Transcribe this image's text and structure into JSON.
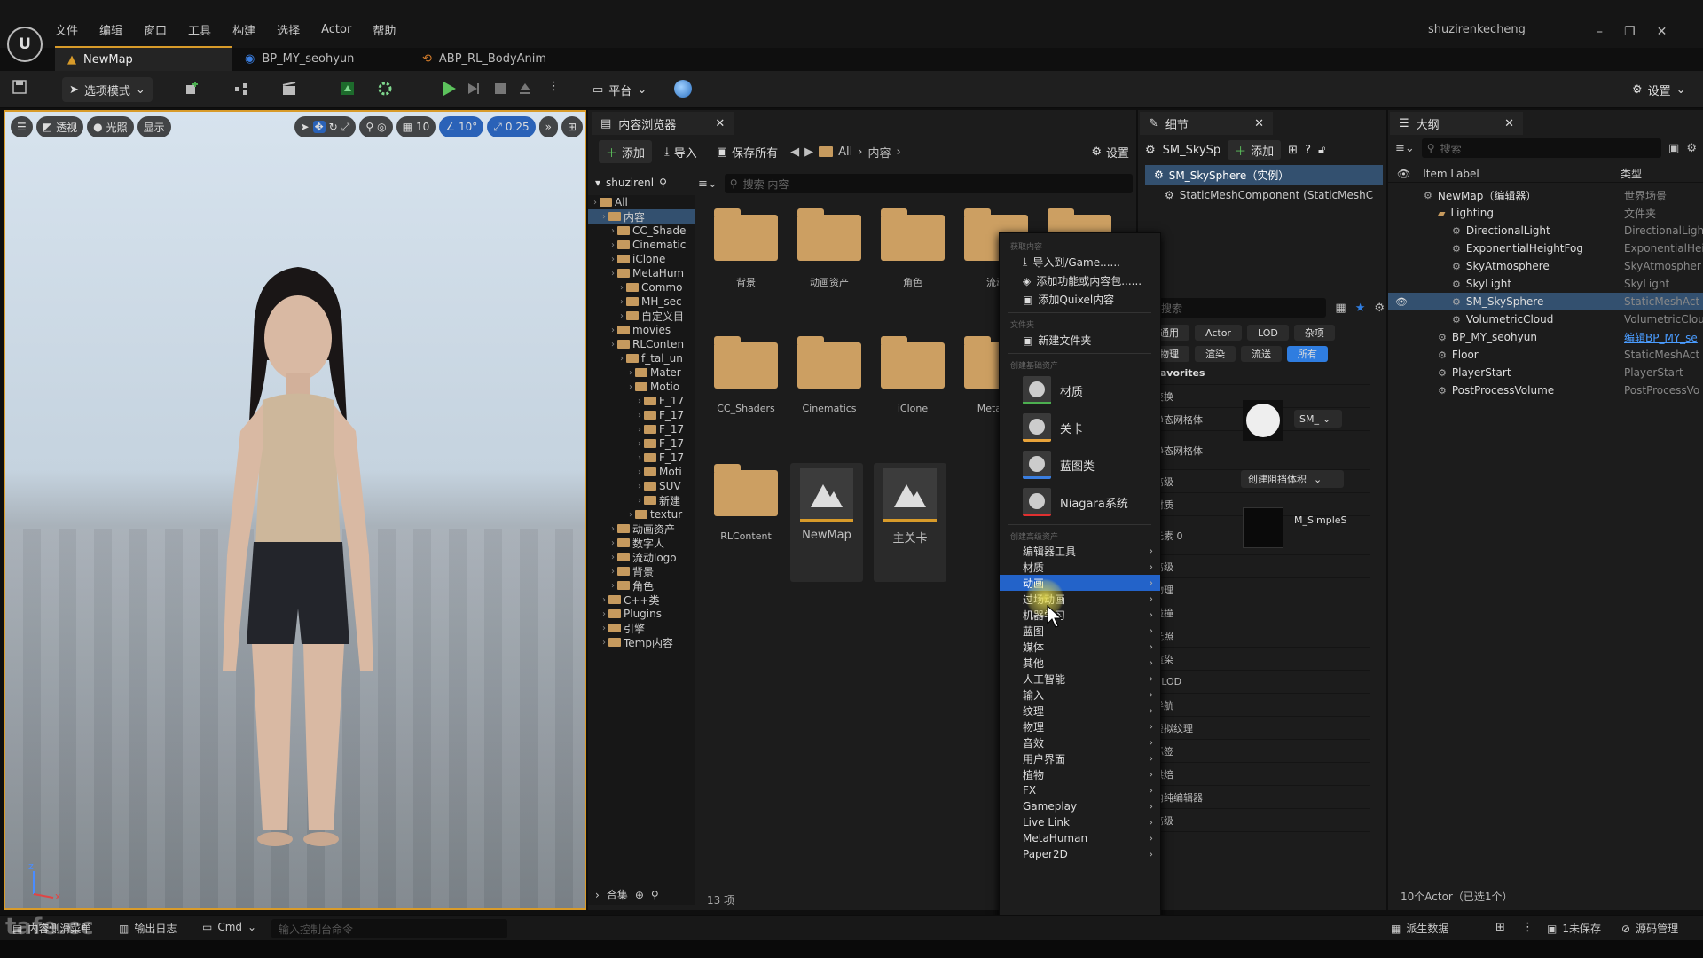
{
  "title_bar": {
    "menu": [
      "文件",
      "编辑",
      "窗口",
      "工具",
      "构建",
      "选择",
      "Actor",
      "帮助"
    ],
    "tabs": [
      {
        "label": "NewMap",
        "active": true
      },
      {
        "label": "BP_MY_seohyun",
        "active": false
      },
      {
        "label": "ABP_RL_BodyAnim",
        "active": false
      }
    ],
    "user": "shuzirenkecheng"
  },
  "toolbar": {
    "mode_label": "选项模式",
    "platform_label": "平台",
    "settings_label": "设置"
  },
  "viewport": {
    "perspective_label": "透视",
    "lit_label": "光照",
    "show_label": "显示",
    "grid_snap": "10",
    "rot_snap": "10°",
    "scale_snap": "0.25",
    "axis_z": "z",
    "axis_x": "x"
  },
  "content_browser": {
    "tab_title": "内容浏览器",
    "add_label": "添加",
    "import_label": "导入",
    "save_all_label": "保存所有",
    "path": [
      "All",
      "内容"
    ],
    "settings_label": "设置",
    "tree_header": "shuzirenl",
    "search_placeholder": "搜索 内容",
    "tree": [
      {
        "label": "All",
        "depth": 0
      },
      {
        "label": "内容",
        "depth": 1,
        "selected": true
      },
      {
        "label": "CC_Shade",
        "depth": 2
      },
      {
        "label": "Cinematic",
        "depth": 2
      },
      {
        "label": "iClone",
        "depth": 2
      },
      {
        "label": "MetaHum",
        "depth": 2
      },
      {
        "label": "Commo",
        "depth": 3
      },
      {
        "label": "MH_sec",
        "depth": 3
      },
      {
        "label": "自定义目",
        "depth": 3
      },
      {
        "label": "movies",
        "depth": 2
      },
      {
        "label": "RLConten",
        "depth": 2
      },
      {
        "label": "f_tal_un",
        "depth": 3
      },
      {
        "label": "Mater",
        "depth": 4
      },
      {
        "label": "Motio",
        "depth": 4
      },
      {
        "label": "F_17",
        "depth": 5
      },
      {
        "label": "F_17",
        "depth": 5
      },
      {
        "label": "F_17",
        "depth": 5
      },
      {
        "label": "F_17",
        "depth": 5
      },
      {
        "label": "F_17",
        "depth": 5
      },
      {
        "label": "Moti",
        "depth": 5
      },
      {
        "label": "SUV",
        "depth": 5
      },
      {
        "label": "新建",
        "depth": 5
      },
      {
        "label": "textur",
        "depth": 4
      },
      {
        "label": "动画资产",
        "depth": 2
      },
      {
        "label": "数字人",
        "depth": 2
      },
      {
        "label": "流动logo",
        "depth": 2
      },
      {
        "label": "背景",
        "depth": 2
      },
      {
        "label": "角色",
        "depth": 2
      },
      {
        "label": "C++类",
        "depth": 1
      },
      {
        "label": "Plugins",
        "depth": 1
      },
      {
        "label": "引擎",
        "depth": 1
      },
      {
        "label": "Temp内容",
        "depth": 1
      }
    ],
    "items": [
      {
        "label": "背景",
        "kind": "folder"
      },
      {
        "label": "动画资产",
        "kind": "folder"
      },
      {
        "label": "角色",
        "kind": "folder"
      },
      {
        "label": "流动",
        "kind": "folder"
      },
      {
        "label": "",
        "kind": "folder"
      },
      {
        "label": "CC_Shaders",
        "kind": "folder"
      },
      {
        "label": "Cinematics",
        "kind": "folder"
      },
      {
        "label": "iClone",
        "kind": "folder"
      },
      {
        "label": "MetaHu",
        "kind": "folder"
      },
      {
        "label": "RLContent",
        "kind": "folder"
      },
      {
        "label": "NewMap",
        "kind": "map"
      },
      {
        "label": "主关卡",
        "kind": "map"
      }
    ],
    "collections_label": "合集",
    "item_count": "13 项"
  },
  "context_menu": {
    "header1": "获取内容",
    "import_label": "导入到/Game......",
    "add_feature_label": "添加功能或内容包......",
    "add_quixel_label": "添加Quixel内容",
    "header2": "文件夹",
    "new_folder_label": "新建文件夹",
    "header3": "创建基础资产",
    "basic": [
      {
        "label": "材质",
        "color": "#4caf50"
      },
      {
        "label": "关卡",
        "color": "#e8a33a"
      },
      {
        "label": "蓝图类",
        "color": "#3a7ee0"
      },
      {
        "label": "Niagara系统",
        "color": "#e03030"
      }
    ],
    "header4": "创建高级资产",
    "advanced": [
      "编辑器工具",
      "材质",
      "动画",
      "过场动画",
      "机器学习",
      "蓝图",
      "媒体",
      "其他",
      "人工智能",
      "输入",
      "纹理",
      "物理",
      "音效",
      "用户界面",
      "植物",
      "FX",
      "Gameplay",
      "Live Link",
      "MetaHuman",
      "Paper2D"
    ],
    "highlighted": "动画"
  },
  "details": {
    "tab_title": "细节",
    "object_name": "SM_SkySp",
    "add_label": "添加",
    "selected_instance": "SM_SkySphere（实例）",
    "component": "StaticMeshComponent (StaticMeshC",
    "search_placeholder": "搜索",
    "filters1": [
      "通用",
      "Actor",
      "LOD",
      "杂项"
    ],
    "filters2": [
      "物理",
      "渲染",
      "流送",
      "所有"
    ],
    "sections": [
      "Favorites",
      "变换",
      "静态网格体",
      "静态网格体",
      "高级",
      "材质",
      "元素 0",
      "高级",
      "物理",
      "碰撞",
      "光照",
      "渲染",
      "HLOD",
      "导航",
      "虚拟纹理",
      "标签",
      "烘焙",
      "内纯编辑器",
      "高级"
    ],
    "mesh_value": "SM_",
    "create_blocker": "创建阻挡体积",
    "material_value": "M_SimpleS"
  },
  "outliner": {
    "tab_title": "大纲",
    "search_placeholder": "搜索",
    "col_label": "Item Label",
    "col_type": "类型",
    "rows": [
      {
        "label": "NewMap（编辑器）",
        "type": "世界场景",
        "depth": 0
      },
      {
        "label": "Lighting",
        "type": "文件夹",
        "depth": 1
      },
      {
        "label": "DirectionalLight",
        "type": "DirectionalLigh",
        "depth": 2
      },
      {
        "label": "ExponentialHeightFog",
        "type": "ExponentialHei",
        "depth": 2
      },
      {
        "label": "SkyAtmosphere",
        "type": "SkyAtmospher",
        "depth": 2
      },
      {
        "label": "SkyLight",
        "type": "SkyLight",
        "depth": 2
      },
      {
        "label": "SM_SkySphere",
        "type": "StaticMeshAct",
        "depth": 2,
        "selected": true
      },
      {
        "label": "VolumetricCloud",
        "type": "VolumetricClou",
        "depth": 2
      },
      {
        "label": "BP_MY_seohyun",
        "type": "编辑BP_MY_se",
        "depth": 1,
        "link": true
      },
      {
        "label": "Floor",
        "type": "StaticMeshAct",
        "depth": 1
      },
      {
        "label": "PlayerStart",
        "type": "PlayerStart",
        "depth": 1
      },
      {
        "label": "PostProcessVolume",
        "type": "PostProcessVo",
        "depth": 1
      }
    ],
    "footer": "10个Actor（已选1个）"
  },
  "status_bar": {
    "content_drawer": "内容侧滑菜单",
    "output_log": "输出日志",
    "cmd_label": "Cmd",
    "console_placeholder": "输入控制台命令",
    "derived_data": "派生数据",
    "unsaved": "1未保存",
    "source_control": "源码管理",
    "watermark": "tafe.cc"
  }
}
